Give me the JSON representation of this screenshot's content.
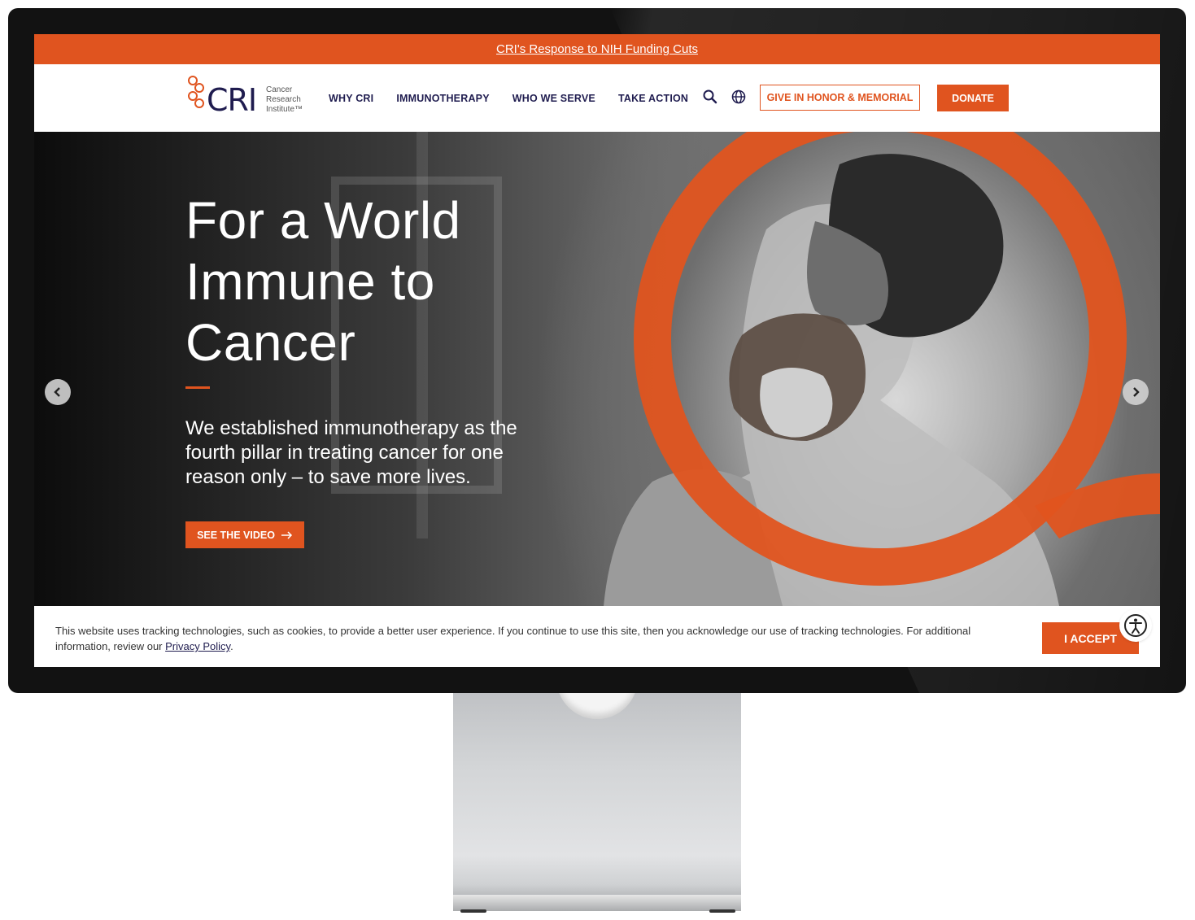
{
  "top_banner": {
    "link_text": "CRI's Response to NIH Funding Cuts"
  },
  "logo": {
    "wordmark": "CRI",
    "line1": "Cancer",
    "line2": "Research",
    "line3": "Institute™"
  },
  "nav": {
    "items": [
      {
        "label": "WHY CRI"
      },
      {
        "label": "IMMUNOTHERAPY"
      },
      {
        "label": "WHO WE SERVE"
      },
      {
        "label": "TAKE ACTION"
      }
    ],
    "search_icon": "search-icon",
    "language_icon": "globe-icon",
    "honor_button": "GIVE IN HONOR & MEMORIAL",
    "donate_button": "DONATE"
  },
  "hero": {
    "title_line1": "For a World",
    "title_line2": "Immune to",
    "title_line3": "Cancer",
    "subtitle": "We established immunotherapy as the fourth pillar in treating cancer for one reason only – to save more lives.",
    "cta": "SEE THE VIDEO",
    "cta_icon": "arrow-right-icon",
    "prev_icon": "chevron-left-icon",
    "next_icon": "chevron-right-icon"
  },
  "cookie": {
    "text": "This website uses tracking technologies, such as cookies, to provide a better user experience. If you continue to use this site, then you acknowledge our use of tracking technologies. For additional information, review our ",
    "link": "Privacy Policy",
    "suffix": ".",
    "accept": "I ACCEPT",
    "accessibility_icon": "accessibility-icon"
  },
  "colors": {
    "brand_orange": "#e0541f",
    "navy": "#1f1c4f"
  }
}
